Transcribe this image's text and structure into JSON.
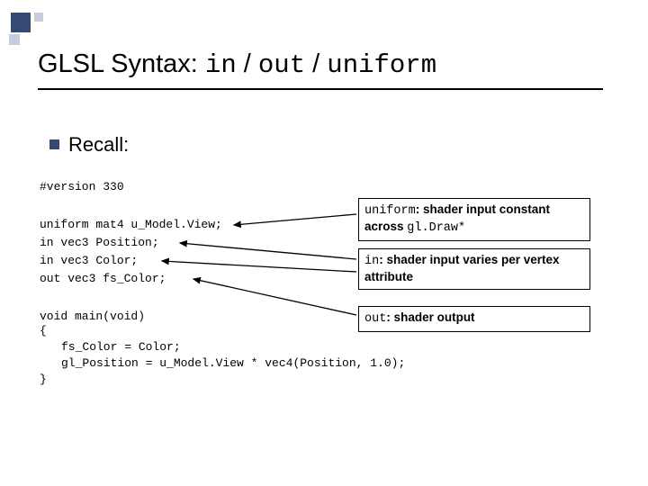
{
  "title": {
    "prefix": "GLSL Syntax: ",
    "kw1": "in",
    "sep": " / ",
    "kw2": "out",
    "kw3": "uniform"
  },
  "recall": "Recall:",
  "code": {
    "version": "#version 330",
    "line_uniform": "uniform mat4 u_Model.View;",
    "line_in1": "in vec3 Position;",
    "line_in2": "in vec3 Color;",
    "line_out": "out vec3 fs_Color;",
    "main_sig": "void main(void)",
    "brace_open": "{",
    "body1": "fs_Color = Color;",
    "body2": "gl_Position = u_Model.View * vec4(Position, 1.0);",
    "brace_close": "}"
  },
  "callouts": {
    "uniform_kw": "uniform",
    "uniform_txt1": ": shader input constant",
    "uniform_txt2": "across ",
    "uniform_code": "gl.Draw*",
    "in_kw": "in",
    "in_txt": ": shader input varies per vertex attribute",
    "out_kw": "out",
    "out_txt": ": shader output"
  }
}
